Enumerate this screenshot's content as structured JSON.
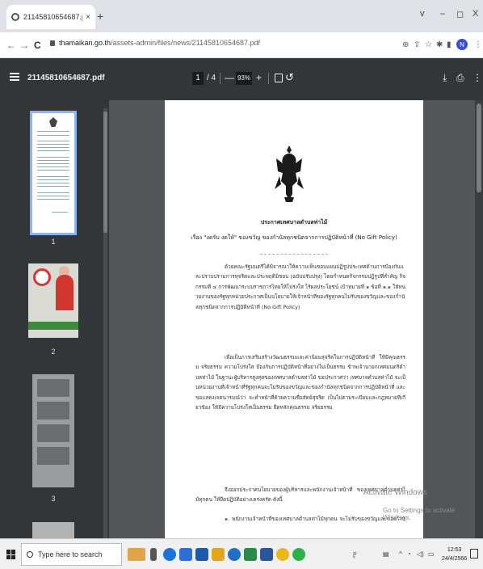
{
  "browser": {
    "tab_title": "21145810654687.pdf",
    "tab_close": "×",
    "new_tab": "+",
    "window_controls": {
      "tabsearch": "v",
      "minimize": "–",
      "restore": "◻",
      "close": "X"
    },
    "nav": {
      "back": "←",
      "forward": "→",
      "reload": "C"
    },
    "url_domain": "thamaikan.go.th",
    "url_path": "/assets-admin/files/news/21145810654687.pdf",
    "profile_initial": "N"
  },
  "pdf_toolbar": {
    "filename": "21145810654687.pdf",
    "current_page": "1",
    "total_pages": "/ 4",
    "zoom_out": "—",
    "zoom_value": "93%",
    "zoom_in": "+",
    "rotate": "↺",
    "download": "⤓",
    "print": "⎙",
    "more": "⋮"
  },
  "thumbnails": [
    {
      "label": "1"
    },
    {
      "label": "2"
    },
    {
      "label": "3"
    }
  ],
  "document": {
    "title": "ประกาศเทศบาลตำบลท่าไม้",
    "subject": "เรื่อง \"งดรับ งดให้\" ของขวัญ ของกำนัลทุกชนิดจากการปฏิบัติหน้าที่ (No Gift Policy)",
    "paragraph1": "ด้วยคณะรัฐมนตรีได้พิจารณาให้ความเห็นชอบแผนปฏิรูปประเทศด้านการป้องกันและปราบปรามการทุจริตและประพฤติมิชอบ (ฉบับปรับปรุง) โดยกำหนดกิจกรรมปฏิรูปที่สำคัญ กิจกรรมที่ ๔ การพัฒนาระบบราชการไทยให้โปร่งใส ไร้ผลประโยชน์ เป้าหมายที่ ๑ ข้อที่ ๑.๑ ให้หน่วยงานของรัฐทุกหน่วยประกาศเป็นนโยบายให้เจ้าหน้าที่ของรัฐทุกคนไม่รับของขวัญและของกำนัลทุกชนิดจากการปฏิบัติหน้าที่ (No Gift Policy)",
    "paragraph2": "เพื่อเป็นการเสริมสร้างวัฒนธรรมและค่านิยมสุจริตในการปฏิบัติหน้าที่ ให้มีคุณธรรม จริยธรรม ความโปร่งใส ป้องกันการปฏิบัติหน้าที่อย่างไม่เป็นธรรม ข้าพเจ้านายกเทศมนตรีตำบลท่าไม้ ในฐานะผู้บริหารสูงสุดของเทศบาลตำบลท่าไม้ ขอประกาศว่า เทศบาลตำบลท่าไม้ จะเป็นหน่วยงานที่เจ้าหน้าที่รัฐทุกคนจะไม่รับของขวัญและของกำนัลทุกชนิดจากการปฏิบัติหน้าที่ และขอแสดงเจตนารมณ์ว่า จะทำหน้าที่ด้วยความซื่อสัตย์สุจริต เป็นไปตามระเบียบและกฎหมายที่เกี่ยวข้อง ให้มีความโปร่งใสเป็นธรรม ยึดหลักคุณธรรม จริยธรรม",
    "paragraph3": "จึงออกประกาศนโยบายของผู้บริหารและพนักงานเจ้าหน้าที่ ของเทศบาลตำบลท่าไม้ทุกคน ให้ยึดปฏิบัติอย่างเคร่งครัด ดังนี้",
    "paragraph4": "๑. พนักงานเจ้าหน้าที่ของเทศบาลตำบลท่าไม้ทุกคน จะไม่รับของขวัญและของกำนัล"
  },
  "watermark": {
    "line1": "Activate Windows",
    "line2": "Go to Settings to activate Windows."
  },
  "taskbar": {
    "search_placeholder": "Type here to search",
    "time": "12:53",
    "date": "24/4/2566"
  },
  "colors": {
    "chrome_bg": "#dee1e6",
    "pdf_toolbar": "#323639",
    "viewer_bg": "#525659",
    "thumb_selected": "#8ab4f8",
    "profile": "#3a4fd1"
  }
}
